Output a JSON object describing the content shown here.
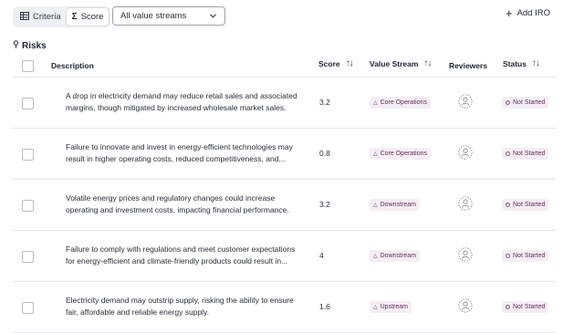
{
  "toolbar": {
    "criteria_label": "Criteria",
    "score_label": "Score",
    "value_stream_select": "All value streams",
    "add_iro_label": "Add IRO"
  },
  "section": {
    "title": "Risks"
  },
  "table": {
    "columns": {
      "description": "Description",
      "score": "Score",
      "value_stream": "Value Stream",
      "reviewers": "Reviewers",
      "status": "Status"
    },
    "rows": [
      {
        "description": "A drop in electricity demand may reduce retail sales and associated margins, though mitigated by increased wholesale market sales.",
        "score": "3.2",
        "value_stream": "Core Operations",
        "status": "Not Started"
      },
      {
        "description": "Failure to innovate and invest in energy-efficient technologies may result in higher operating costs, reduced competitiveness, and...",
        "score": "0.8",
        "value_stream": "Core Operations",
        "status": "Not Started"
      },
      {
        "description": "Volatile energy prices and regulatory changes could increase operating and investment costs, impacting financial performance.",
        "score": "3.2",
        "value_stream": "Downstream",
        "status": "Not Started"
      },
      {
        "description": "Failure to comply with regulations and meet customer expectations for energy-efficient and climate-friendly products could result in...",
        "score": "4",
        "value_stream": "Downstream",
        "status": "Not Started"
      },
      {
        "description": "Electricity demand may outstrip supply, risking the ability to ensure fair, affordable and reliable energy supply.",
        "score": "1.6",
        "value_stream": "Upstream",
        "status": "Not Started"
      }
    ]
  }
}
